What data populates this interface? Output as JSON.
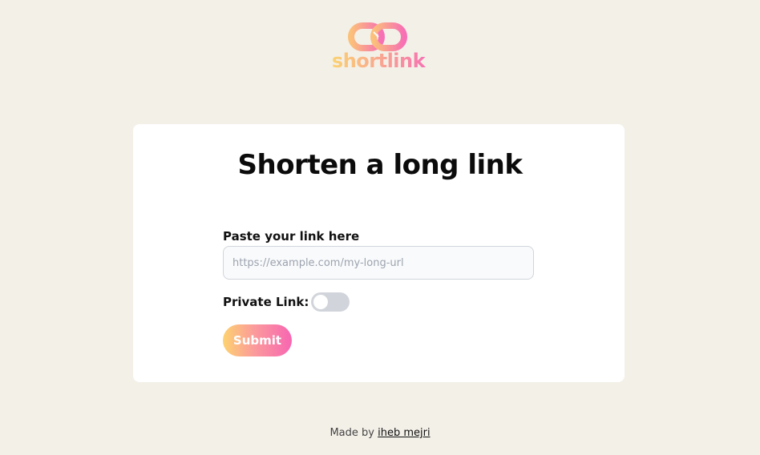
{
  "brand": {
    "name": "shortlink",
    "gradient_start": "#fbd56f",
    "gradient_end": "#f76fb4"
  },
  "card": {
    "title": "Shorten a long link",
    "link_label": "Paste your link here",
    "link_placeholder": "https://example.com/my-long-url",
    "link_value": "",
    "private_label": "Private Link:",
    "private_enabled": false,
    "submit_label": "Submit"
  },
  "footer": {
    "prefix": "Made by",
    "author": "iheb mejri"
  }
}
